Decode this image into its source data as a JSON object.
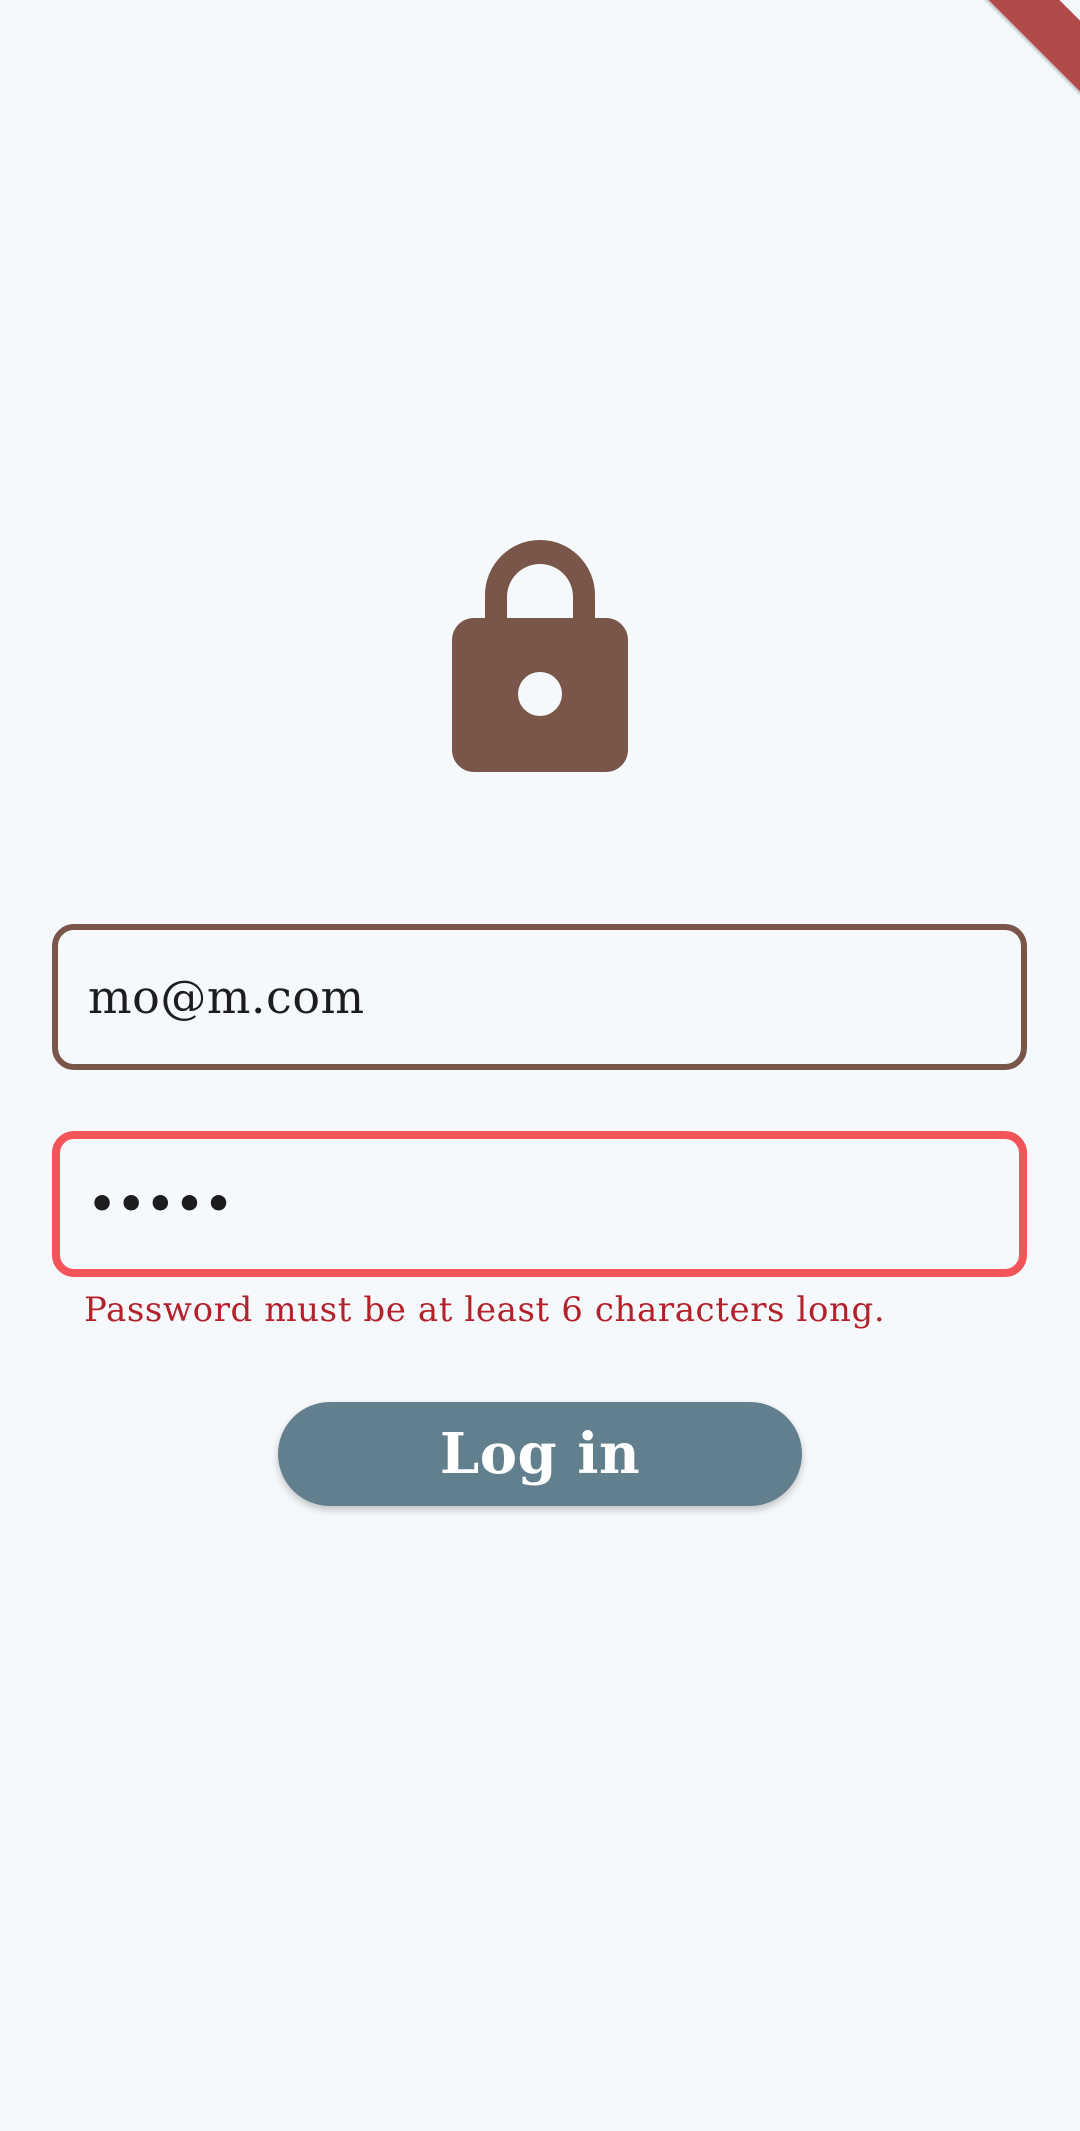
{
  "theme": {
    "background": "#f6f9fc",
    "accent": "#7a554a",
    "error": "#f2545a",
    "error_text": "#b3222a",
    "button_bg": "#617f8c",
    "debug_banner": "#b24a4a"
  },
  "header": {
    "icon": "lock-icon"
  },
  "form": {
    "email": {
      "value": "mo@m.com"
    },
    "password": {
      "value": "•••••",
      "error": "Password must be at least 6 characters long."
    },
    "login_label": "Log in"
  }
}
